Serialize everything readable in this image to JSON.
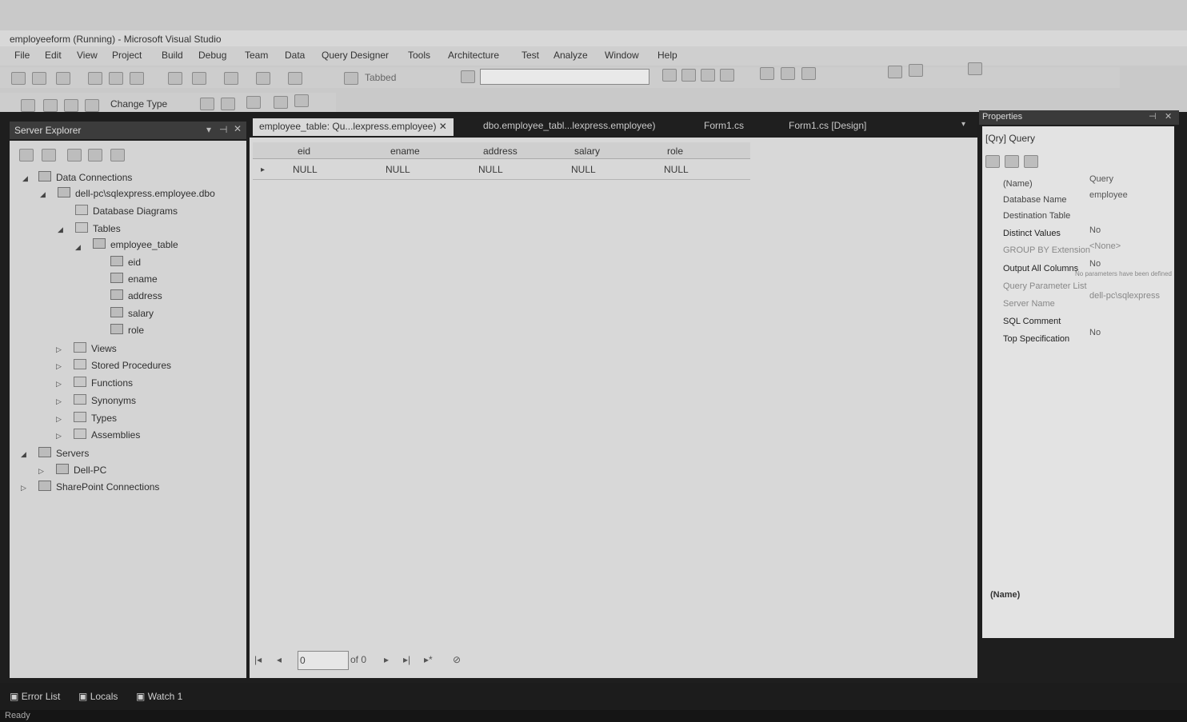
{
  "window": {
    "title": "employeeform (Running) - Microsoft Visual Studio"
  },
  "menu": [
    "File",
    "Edit",
    "View",
    "Project",
    "Build",
    "Debug",
    "Team",
    "Data",
    "Query Designer",
    "Tools",
    "Architecture",
    "Test",
    "Analyze",
    "Window",
    "Help"
  ],
  "toolbar": {
    "debug_target": "Tabbed",
    "change_type_label": "Change Type"
  },
  "server_explorer": {
    "title": "Server Explorer",
    "tree": {
      "data_connections": "Data Connections",
      "connection": "dell-pc\\sqlexpress.employee.dbo",
      "database_diagrams": "Database Diagrams",
      "tables": "Tables",
      "employee_table": "employee_table",
      "columns": [
        "eid",
        "ename",
        "address",
        "salary",
        "role"
      ],
      "views": "Views",
      "stored_procedures": "Stored Procedures",
      "functions": "Functions",
      "synonyms": "Synonyms",
      "types": "Types",
      "assemblies": "Assemblies",
      "servers": "Servers",
      "server_name": "Dell-PC",
      "sharepoint": "SharePoint Connections"
    }
  },
  "tabs": [
    {
      "label": "employee_table: Qu...lexpress.employee)",
      "active": true
    },
    {
      "label": "dbo.employee_tabl...lexpress.employee)",
      "active": false
    },
    {
      "label": "Form1.cs",
      "active": false
    },
    {
      "label": "Form1.cs [Design]",
      "active": false
    }
  ],
  "grid": {
    "columns": [
      "eid",
      "ename",
      "address",
      "salary",
      "role"
    ],
    "row": [
      "NULL",
      "NULL",
      "NULL",
      "NULL",
      "NULL"
    ],
    "nav_value": "0",
    "nav_of": "of 0"
  },
  "properties": {
    "title": "Properties",
    "subject": "[Qry] Query",
    "rows": [
      {
        "name": "(Name)",
        "value": "Query"
      },
      {
        "name": "Database Name",
        "value": "employee"
      },
      {
        "name": "Destination Table",
        "value": ""
      },
      {
        "name": "Distinct Values",
        "value": "No"
      },
      {
        "name": "GROUP BY Extension",
        "value": "<None>"
      },
      {
        "name": "Output All Columns",
        "value": "No"
      },
      {
        "name": "Query Parameter List",
        "value": "No parameters have been defined"
      },
      {
        "name": "Server Name",
        "value": "dell-pc\\sqlexpress"
      },
      {
        "name": "SQL Comment",
        "value": ""
      },
      {
        "name": "Top Specification",
        "value": "No"
      }
    ],
    "footer": "(Name)"
  },
  "bottom_tabs": [
    "Error List",
    "Locals",
    "Watch 1"
  ],
  "status": "Ready"
}
